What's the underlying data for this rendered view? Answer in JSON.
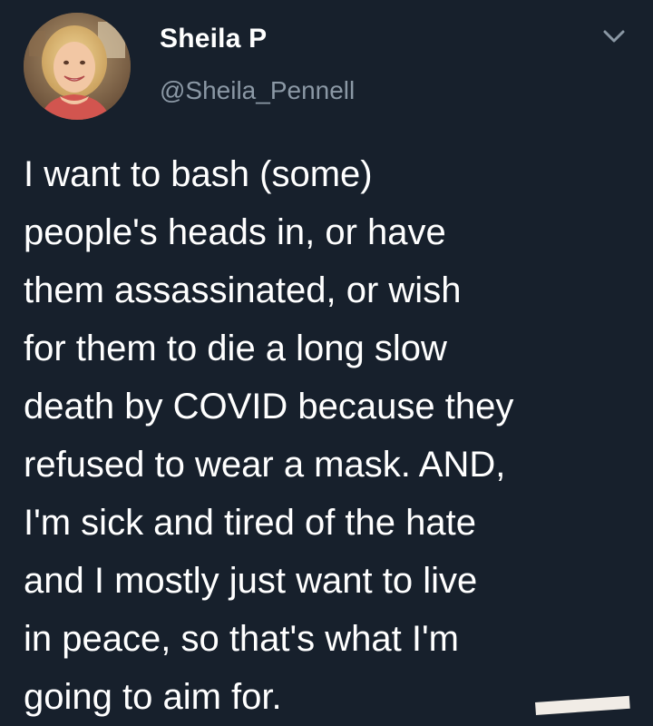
{
  "author": {
    "display_name": "Sheila P",
    "handle": "@Sheila_Pennell",
    "avatar_icon": "profile-photo"
  },
  "menu": {
    "icon": "chevron-down-icon",
    "color": "#8b98a5"
  },
  "tweet": {
    "lines": [
      "I want to bash (some)",
      "people's heads in, or have",
      "them assassinated, or wish",
      "for them to die a long slow",
      "death by COVID because they",
      "refused to wear a mask. AND,",
      "I'm sick and tired of the hate",
      "and I mostly just want to live",
      "in peace, so that's what I'm",
      "going to aim for."
    ]
  },
  "colors": {
    "background": "#17202c",
    "text": "#ffffff",
    "secondary_text": "#8b98a5"
  }
}
